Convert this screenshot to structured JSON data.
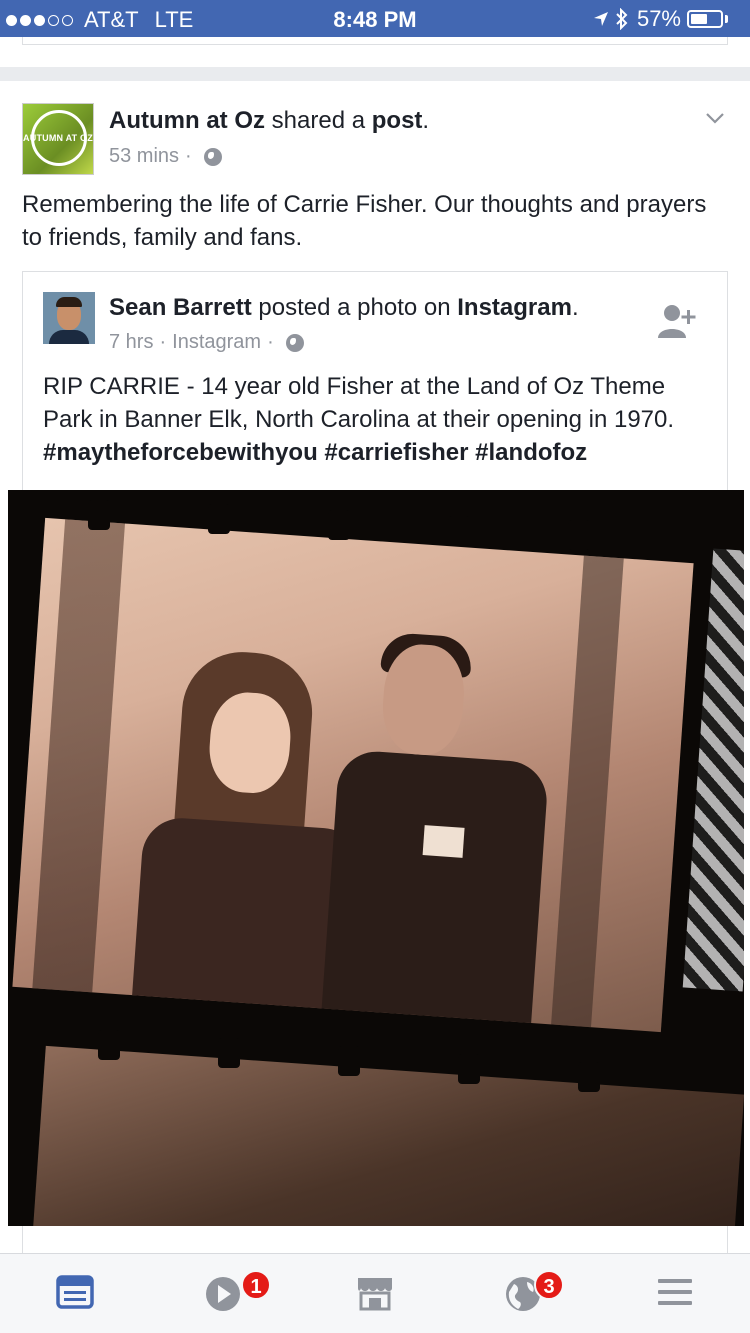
{
  "status_bar": {
    "carrier": "AT&T",
    "network": "LTE",
    "time": "8:48 PM",
    "battery": "57%",
    "battery_level": 0.57
  },
  "post": {
    "page_name": "Autumn at Oz",
    "action_text": "shared a",
    "action_object": "post",
    "period": ".",
    "avatar_text": "AUTUMN AT OZ",
    "time": "53 mins",
    "separator": "·",
    "text": "Remembering the life of Carrie Fisher. Our thoughts and prayers to friends, family and fans."
  },
  "shared_post": {
    "author": "Sean Barrett",
    "action_text": "posted a photo on",
    "platform": "Instagram",
    "period": ".",
    "time": "7 hrs",
    "source": "Instagram",
    "separator": "·",
    "text_plain": "RIP CARRIE - 14 year old Fisher at the Land of Oz Theme Park in Banner Elk, North Carolina at their opening in 1970.",
    "hashtags": "#maytheforcebewithyou #carriefisher #landofoz"
  },
  "tab_bar": {
    "video_badge": "1",
    "notifications_badge": "3"
  },
  "colors": {
    "brand_blue": "#4267b2",
    "tab_active": "#4267b2",
    "tab_inactive": "#90949c",
    "badge_red": "#e41b17"
  }
}
